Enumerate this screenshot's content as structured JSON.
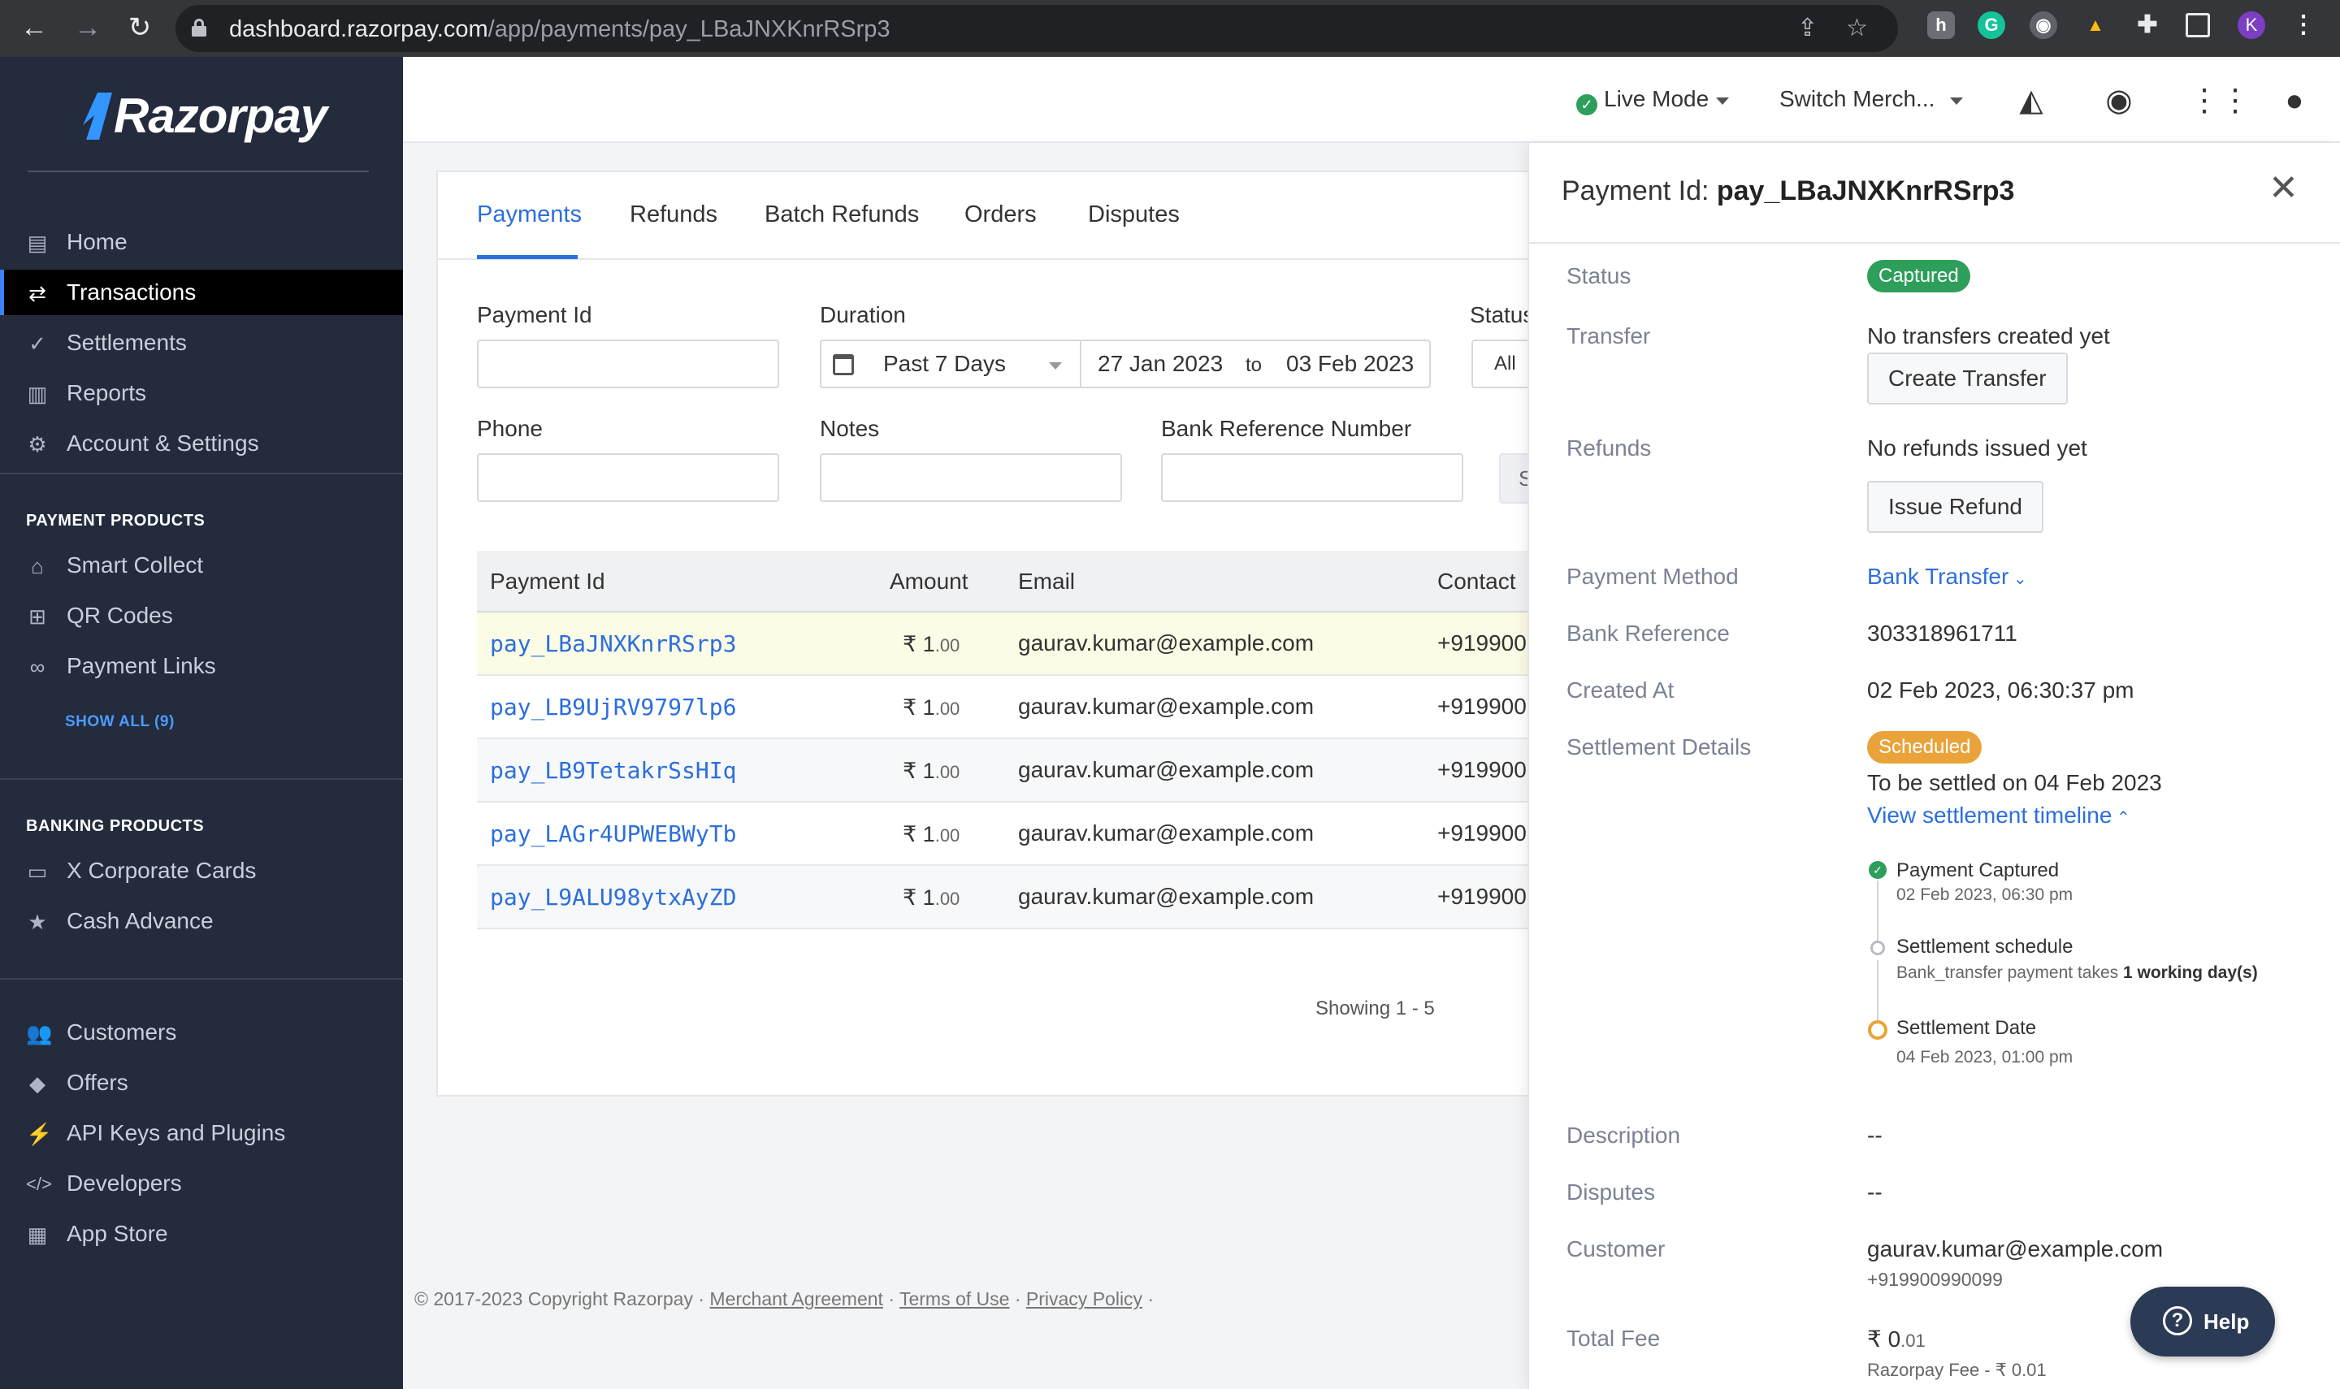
{
  "browser": {
    "url_host": "dashboard.razorpay.com",
    "url_path": "/app/payments/pay_LBaJNXKnrRSrp3",
    "profile_initial": "K"
  },
  "sidebar": {
    "logo": "Razorpay",
    "main_items": [
      {
        "label": "Home",
        "icon": "home-icon"
      },
      {
        "label": "Transactions",
        "icon": "transactions-icon",
        "active": true
      },
      {
        "label": "Settlements",
        "icon": "settlements-icon"
      },
      {
        "label": "Reports",
        "icon": "reports-icon"
      },
      {
        "label": "Account & Settings",
        "icon": "gear-icon"
      }
    ],
    "payment_products_title": "PAYMENT PRODUCTS",
    "payment_products": [
      {
        "label": "Smart Collect",
        "icon": "bank-icon"
      },
      {
        "label": "QR Codes",
        "icon": "qr-icon"
      },
      {
        "label": "Payment Links",
        "icon": "link-icon"
      }
    ],
    "show_all": "SHOW ALL (9)",
    "banking_products_title": "BANKING PRODUCTS",
    "banking_products": [
      {
        "label": "X Corporate Cards",
        "icon": "card-icon"
      },
      {
        "label": "Cash Advance",
        "icon": "star-icon"
      }
    ],
    "other_items": [
      {
        "label": "Customers",
        "icon": "customers-icon"
      },
      {
        "label": "Offers",
        "icon": "tag-icon"
      },
      {
        "label": "API Keys and Plugins",
        "icon": "plug-icon"
      },
      {
        "label": "Developers",
        "icon": "code-icon"
      },
      {
        "label": "App Store",
        "icon": "apps-icon"
      }
    ]
  },
  "header": {
    "mode": "Live Mode",
    "switch_merchant": "Switch Merch..."
  },
  "tabs": [
    "Payments",
    "Refunds",
    "Batch Refunds",
    "Orders",
    "Disputes"
  ],
  "filters": {
    "payment_id": "Payment Id",
    "duration": "Duration",
    "duration_value": "Past 7 Days",
    "from_date": "27 Jan 2023",
    "to_label": "to",
    "to_date": "03 Feb 2023",
    "status": "Status",
    "status_value": "All",
    "phone": "Phone",
    "notes": "Notes",
    "bank_ref": "Bank Reference Number",
    "search_cut": "S"
  },
  "table": {
    "headers": [
      "Payment Id",
      "Amount",
      "Email",
      "Contact"
    ],
    "rows": [
      {
        "id": "pay_LBaJNXKnrRSrp3",
        "amount_int": "₹ 1",
        "amount_dec": ".00",
        "email": "gaurav.kumar@example.com",
        "contact": "+919900"
      },
      {
        "id": "pay_LB9UjRV9797lp6",
        "amount_int": "₹ 1",
        "amount_dec": ".00",
        "email": "gaurav.kumar@example.com",
        "contact": "+919900"
      },
      {
        "id": "pay_LB9TetakrSsHIq",
        "amount_int": "₹ 1",
        "amount_dec": ".00",
        "email": "gaurav.kumar@example.com",
        "contact": "+919900"
      },
      {
        "id": "pay_LAGr4UPWEBWyTb",
        "amount_int": "₹ 1",
        "amount_dec": ".00",
        "email": "gaurav.kumar@example.com",
        "contact": "+919900"
      },
      {
        "id": "pay_L9ALU98ytxAyZD",
        "amount_int": "₹ 1",
        "amount_dec": ".00",
        "email": "gaurav.kumar@example.com",
        "contact": "+919900"
      }
    ],
    "showing": "Showing 1 - 5"
  },
  "footer": {
    "copyright": "© 2017-2023 Copyright Razorpay · ",
    "merchant_agreement": "Merchant Agreement",
    "terms": "Terms of Use",
    "privacy": "Privacy Policy",
    "sep": " · "
  },
  "panel": {
    "title_prefix": "Payment Id: ",
    "title_id": "pay_LBaJNXKnrRSrp3",
    "status_label": "Status",
    "status_badge": "Captured",
    "transfer_label": "Transfer",
    "transfer_value": "No transfers created yet",
    "create_transfer": "Create Transfer",
    "refunds_label": "Refunds",
    "refunds_value": "No refunds issued yet",
    "issue_refund": "Issue Refund",
    "method_label": "Payment Method",
    "method_value": "Bank Transfer",
    "bankref_label": "Bank Reference",
    "bankref_value": "303318961711",
    "created_label": "Created At",
    "created_value": "02 Feb 2023, 06:30:37 pm",
    "settlement_label": "Settlement Details",
    "settlement_badge": "Scheduled",
    "settlement_text": "To be settled on 04 Feb 2023",
    "timeline_link": "View settlement timeline",
    "timeline": [
      {
        "title": "Payment Captured",
        "sub": "02 Feb 2023, 06:30 pm"
      },
      {
        "title": "Settlement schedule",
        "sub_prefix": "Bank_transfer payment takes ",
        "sub_bold": "1 working day(s)"
      },
      {
        "title": "Settlement Date",
        "sub": "04 Feb 2023, 01:00 pm"
      }
    ],
    "description_label": "Description",
    "description_value": "--",
    "disputes_label": "Disputes",
    "disputes_value": "--",
    "customer_label": "Customer",
    "customer_email": "gaurav.kumar@example.com",
    "customer_phone": "+919900990099",
    "fee_label": "Total Fee",
    "fee_int": "₹ 0",
    "fee_dec": ".01",
    "fee_sub": "Razorpay Fee - ₹ 0.01"
  },
  "help": "Help",
  "colors": {
    "accent": "#2c6fdc",
    "success": "#2e9e5b",
    "warning": "#e9a33a",
    "sidebar": "#232b3d"
  }
}
